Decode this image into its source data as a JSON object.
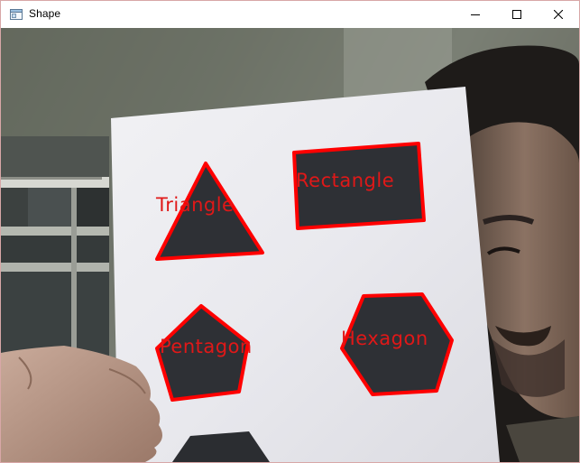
{
  "window": {
    "title": "Shape",
    "controls": {
      "minimize_icon": "minimize-icon",
      "maximize_icon": "maximize-icon",
      "close_icon": "close-icon"
    }
  },
  "camera_frame": {
    "detection_color": "#ff0000",
    "label_color": "#e01818",
    "detected_shapes": [
      {
        "label": "Triangle"
      },
      {
        "label": "Rectangle"
      },
      {
        "label": "Pentagon"
      },
      {
        "label": "Hexagon"
      }
    ]
  }
}
